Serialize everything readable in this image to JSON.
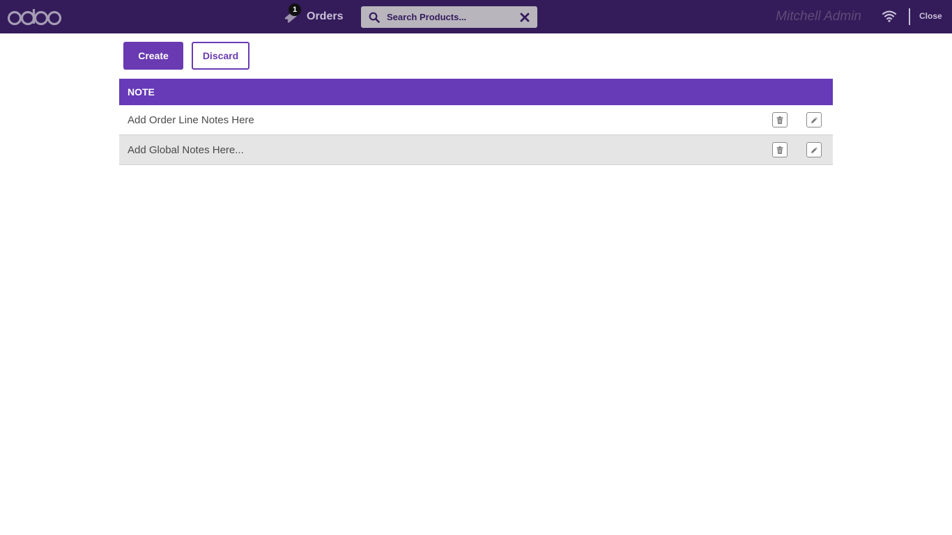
{
  "header": {
    "logo_text": "odoo",
    "orders": {
      "badge_count": "1",
      "label": "Orders"
    },
    "search": {
      "placeholder": "Search Products..."
    },
    "cashier_name": "Mitchell Admin",
    "close_label": "Close"
  },
  "actions": {
    "create_label": "Create",
    "discard_label": "Discard"
  },
  "table": {
    "column_header": "NOTE",
    "rows": [
      {
        "note": "Add Order Line Notes Here"
      },
      {
        "note": "Add Global Notes Here..."
      }
    ]
  },
  "colors": {
    "topbar": "#341b5a",
    "primary": "#6a3ab2",
    "table_header": "#673ab7",
    "row_alt": "#e5e5e5"
  },
  "icons": {
    "orders": "ticket-icon",
    "search": "search-icon",
    "clear": "close-x-icon",
    "wifi": "wifi-icon",
    "delete": "trash-icon",
    "edit": "pencil-icon"
  }
}
